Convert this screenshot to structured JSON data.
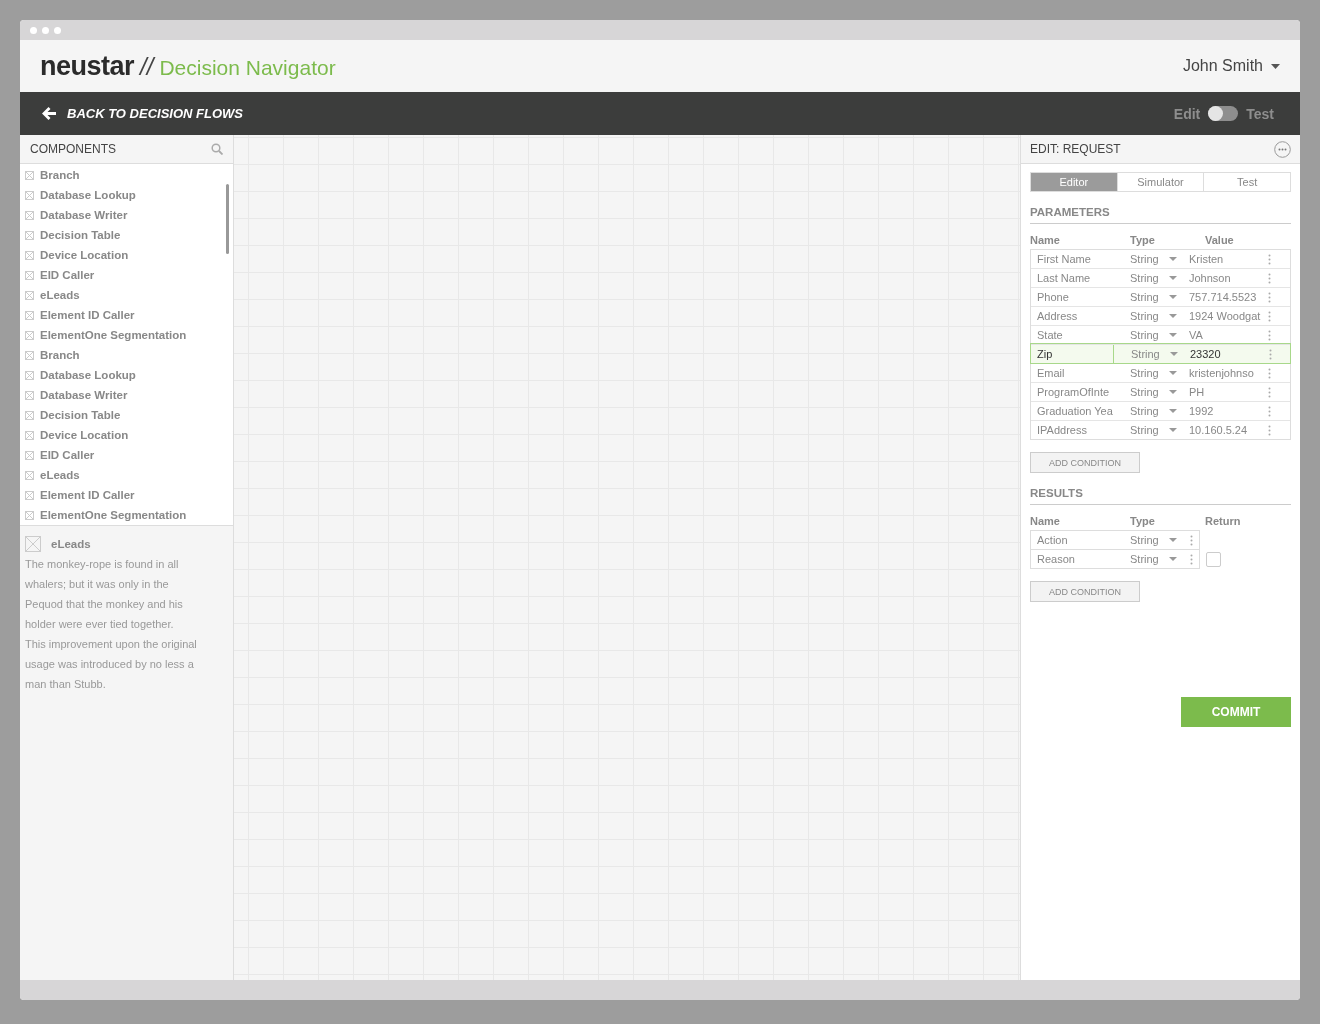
{
  "brand": {
    "logo": "neustar",
    "separator": "//",
    "product": "Decision Navigator"
  },
  "user": {
    "name": "John Smith"
  },
  "toolbar": {
    "back_label": "BACK TO DECISION FLOWS",
    "mode_left": "Edit",
    "mode_right": "Test",
    "test_mode": false
  },
  "sidebar": {
    "title": "COMPONENTS",
    "items": [
      {
        "label": "Branch"
      },
      {
        "label": "Database Lookup"
      },
      {
        "label": "Database Writer"
      },
      {
        "label": "Decision Table"
      },
      {
        "label": "Device Location"
      },
      {
        "label": "EID Caller"
      },
      {
        "label": "eLeads"
      },
      {
        "label": "Element ID Caller"
      },
      {
        "label": "ElementOne Segmentation"
      },
      {
        "label": "Branch"
      },
      {
        "label": "Database Lookup"
      },
      {
        "label": "Database Writer"
      },
      {
        "label": "Decision Table"
      },
      {
        "label": "Device Location"
      },
      {
        "label": "EID Caller"
      },
      {
        "label": "eLeads"
      },
      {
        "label": "Element ID Caller"
      },
      {
        "label": "ElementOne Segmentation"
      }
    ],
    "detail": {
      "title": "eLeads",
      "description": "The monkey-rope is found in all whalers; but it was only in the Pequod that the monkey and his holder were ever tied together. This improvement upon the original usage was introduced by no less a man than Stubb."
    }
  },
  "panel": {
    "title": "EDIT: REQUEST",
    "tabs": [
      {
        "label": "Editor",
        "selected": true
      },
      {
        "label": "Simulator",
        "selected": false
      },
      {
        "label": "Test",
        "selected": false
      }
    ],
    "parameters": {
      "title": "PARAMETERS",
      "columns": [
        "Name",
        "Type",
        "Value"
      ],
      "rows": [
        {
          "name": "First Name",
          "type": "String",
          "value": "Kristen",
          "selected": false
        },
        {
          "name": "Last Name",
          "type": "String",
          "value": "Johnson",
          "selected": false
        },
        {
          "name": "Phone",
          "type": "String",
          "value": "757.714.5523",
          "selected": false
        },
        {
          "name": "Address",
          "type": "String",
          "value": "1924 Woodgat",
          "selected": false
        },
        {
          "name": "State",
          "type": "String",
          "value": "VA",
          "selected": false
        },
        {
          "name": "Zip",
          "type": "String",
          "value": "23320",
          "selected": true
        },
        {
          "name": "Email",
          "type": "String",
          "value": "kristenjohnso",
          "selected": false
        },
        {
          "name": "ProgramOfInte",
          "type": "String",
          "value": "PH",
          "selected": false
        },
        {
          "name": "Graduation Yea",
          "type": "String",
          "value": "1992",
          "selected": false
        },
        {
          "name": "IPAddress",
          "type": "String",
          "value": "10.160.5.24",
          "selected": false
        }
      ],
      "add_button": "ADD CONDITION"
    },
    "results": {
      "title": "RESULTS",
      "columns": [
        "Name",
        "Type",
        "Return"
      ],
      "rows": [
        {
          "kind": "plain",
          "name": "Action",
          "type": "String"
        },
        {
          "kind": "checkbox",
          "name": "Reason",
          "type": "String",
          "checked": false
        }
      ],
      "add_button": "ADD CONDITION"
    },
    "commit": "COMMIT"
  }
}
